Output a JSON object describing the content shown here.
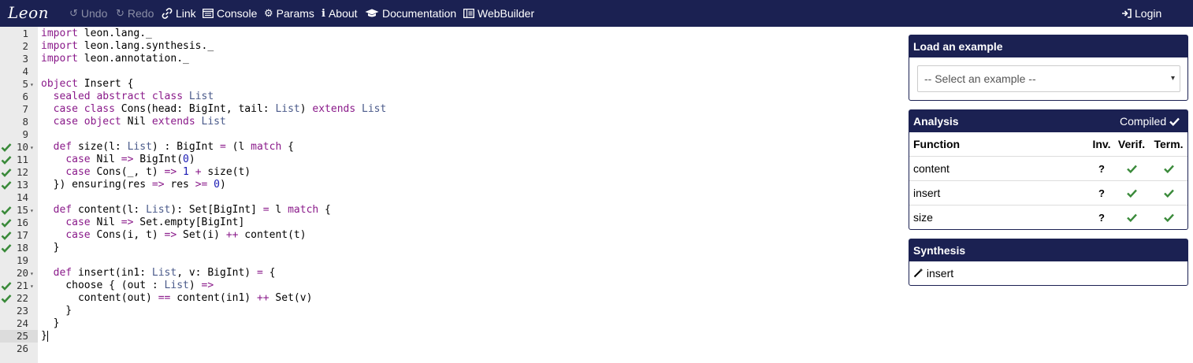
{
  "navbar": {
    "brand": "Leon",
    "items": [
      {
        "label": "Undo",
        "icon": "undo-icon",
        "enabled": false
      },
      {
        "label": "Redo",
        "icon": "redo-icon",
        "enabled": false
      },
      {
        "label": "Link",
        "icon": "link-icon",
        "enabled": true
      },
      {
        "label": "Console",
        "icon": "console-icon",
        "enabled": true
      },
      {
        "label": "Params",
        "icon": "gear-icon",
        "enabled": true
      },
      {
        "label": "About",
        "icon": "info-icon",
        "enabled": true
      },
      {
        "label": "Documentation",
        "icon": "graduation-cap-icon",
        "enabled": true
      },
      {
        "label": "WebBuilder",
        "icon": "webbuilder-icon",
        "enabled": true
      }
    ],
    "login": "Login"
  },
  "editor": {
    "active_line": 25,
    "lines": [
      {
        "n": "1",
        "check": false,
        "fold": false
      },
      {
        "n": "2",
        "check": false,
        "fold": false
      },
      {
        "n": "3",
        "check": false,
        "fold": false
      },
      {
        "n": "4",
        "check": false,
        "fold": false
      },
      {
        "n": "5",
        "check": false,
        "fold": true
      },
      {
        "n": "6",
        "check": false,
        "fold": false
      },
      {
        "n": "7",
        "check": false,
        "fold": false
      },
      {
        "n": "8",
        "check": false,
        "fold": false
      },
      {
        "n": "9",
        "check": false,
        "fold": false
      },
      {
        "n": "10",
        "check": true,
        "fold": true
      },
      {
        "n": "11",
        "check": true,
        "fold": false
      },
      {
        "n": "12",
        "check": true,
        "fold": false
      },
      {
        "n": "13",
        "check": true,
        "fold": false
      },
      {
        "n": "14",
        "check": false,
        "fold": false
      },
      {
        "n": "15",
        "check": true,
        "fold": true
      },
      {
        "n": "16",
        "check": true,
        "fold": false
      },
      {
        "n": "17",
        "check": true,
        "fold": false
      },
      {
        "n": "18",
        "check": true,
        "fold": false
      },
      {
        "n": "19",
        "check": false,
        "fold": false
      },
      {
        "n": "20",
        "check": false,
        "fold": true
      },
      {
        "n": "21",
        "check": true,
        "fold": true
      },
      {
        "n": "22",
        "check": true,
        "fold": false
      },
      {
        "n": "23",
        "check": false,
        "fold": false
      },
      {
        "n": "24",
        "check": false,
        "fold": false
      },
      {
        "n": "25",
        "check": false,
        "fold": false
      },
      {
        "n": "26",
        "check": false,
        "fold": false
      }
    ],
    "code": [
      [
        [
          "import",
          "kw"
        ],
        [
          " leon.lang._",
          ""
        ]
      ],
      [
        [
          "import",
          "kw"
        ],
        [
          " leon.lang.synthesis._",
          ""
        ]
      ],
      [
        [
          "import",
          "kw"
        ],
        [
          " leon.annotation._",
          ""
        ]
      ],
      [],
      [
        [
          "object",
          "kw"
        ],
        [
          " Insert {",
          ""
        ]
      ],
      [
        [
          "  ",
          ""
        ],
        [
          "sealed",
          "kw"
        ],
        [
          " ",
          ""
        ],
        [
          "abstract",
          "kw"
        ],
        [
          " ",
          ""
        ],
        [
          "class",
          "kw"
        ],
        [
          " ",
          ""
        ],
        [
          "List",
          "ty"
        ]
      ],
      [
        [
          "  ",
          ""
        ],
        [
          "case",
          "kw"
        ],
        [
          " ",
          ""
        ],
        [
          "class",
          "kw"
        ],
        [
          " Cons(head: BigInt, tail: ",
          ""
        ],
        [
          "List",
          "ty"
        ],
        [
          ") ",
          ""
        ],
        [
          "extends",
          "kw"
        ],
        [
          " ",
          ""
        ],
        [
          "List",
          "ty"
        ]
      ],
      [
        [
          "  ",
          ""
        ],
        [
          "case",
          "kw"
        ],
        [
          " ",
          ""
        ],
        [
          "object",
          "kw"
        ],
        [
          " Nil ",
          ""
        ],
        [
          "extends",
          "kw"
        ],
        [
          " ",
          ""
        ],
        [
          "List",
          "ty"
        ]
      ],
      [],
      [
        [
          "  ",
          ""
        ],
        [
          "def",
          "kw"
        ],
        [
          " size(l: ",
          ""
        ],
        [
          "List",
          "ty"
        ],
        [
          ") : BigInt ",
          ""
        ],
        [
          "=",
          "op"
        ],
        [
          " (l ",
          ""
        ],
        [
          "match",
          "kw"
        ],
        [
          " {",
          ""
        ]
      ],
      [
        [
          "    ",
          ""
        ],
        [
          "case",
          "kw"
        ],
        [
          " Nil ",
          ""
        ],
        [
          "=>",
          "op"
        ],
        [
          " BigInt(",
          ""
        ],
        [
          "0",
          "num"
        ],
        [
          ")",
          ""
        ]
      ],
      [
        [
          "    ",
          ""
        ],
        [
          "case",
          "kw"
        ],
        [
          " Cons(_, t) ",
          ""
        ],
        [
          "=>",
          "op"
        ],
        [
          " ",
          ""
        ],
        [
          "1",
          "num"
        ],
        [
          " ",
          ""
        ],
        [
          "+",
          "op"
        ],
        [
          " size(t)",
          ""
        ]
      ],
      [
        [
          "  }) ensuring(res ",
          ""
        ],
        [
          "=>",
          "op"
        ],
        [
          " res ",
          ""
        ],
        [
          ">=",
          "op"
        ],
        [
          " ",
          ""
        ],
        [
          "0",
          "num"
        ],
        [
          ")",
          ""
        ]
      ],
      [],
      [
        [
          "  ",
          ""
        ],
        [
          "def",
          "kw"
        ],
        [
          " content(l: ",
          ""
        ],
        [
          "List",
          "ty"
        ],
        [
          "): Set[BigInt] ",
          ""
        ],
        [
          "=",
          "op"
        ],
        [
          " l ",
          ""
        ],
        [
          "match",
          "kw"
        ],
        [
          " {",
          ""
        ]
      ],
      [
        [
          "    ",
          ""
        ],
        [
          "case",
          "kw"
        ],
        [
          " Nil ",
          ""
        ],
        [
          "=>",
          "op"
        ],
        [
          " Set.empty[BigInt]",
          ""
        ]
      ],
      [
        [
          "    ",
          ""
        ],
        [
          "case",
          "kw"
        ],
        [
          " Cons(i, t) ",
          ""
        ],
        [
          "=>",
          "op"
        ],
        [
          " Set(i) ",
          ""
        ],
        [
          "++",
          "op"
        ],
        [
          " content(t)",
          ""
        ]
      ],
      [
        [
          "  }",
          ""
        ]
      ],
      [],
      [
        [
          "  ",
          ""
        ],
        [
          "def",
          "kw"
        ],
        [
          " insert(in1: ",
          ""
        ],
        [
          "List",
          "ty"
        ],
        [
          ", v: BigInt) ",
          ""
        ],
        [
          "=",
          "op"
        ],
        [
          " {",
          ""
        ]
      ],
      [
        [
          "    choose { (out : ",
          ""
        ],
        [
          "List",
          "ty"
        ],
        [
          ") ",
          ""
        ],
        [
          "=>",
          "op"
        ]
      ],
      [
        [
          "      content(out) ",
          ""
        ],
        [
          "==",
          "op"
        ],
        [
          " content(in1) ",
          ""
        ],
        [
          "++",
          "op"
        ],
        [
          " Set(v)",
          ""
        ]
      ],
      [
        [
          "    }",
          ""
        ]
      ],
      [
        [
          "  }",
          ""
        ]
      ],
      [
        [
          "}",
          ""
        ]
      ],
      []
    ]
  },
  "examples": {
    "title": "Load an example",
    "placeholder": "-- Select an example --"
  },
  "analysis": {
    "title": "Analysis",
    "status": "Compiled",
    "columns": [
      "Function",
      "Inv.",
      "Verif.",
      "Term."
    ],
    "rows": [
      {
        "function": "content",
        "inv": "?",
        "verif": "ok",
        "term": "ok"
      },
      {
        "function": "insert",
        "inv": "?",
        "verif": "ok",
        "term": "ok"
      },
      {
        "function": "size",
        "inv": "?",
        "verif": "ok",
        "term": "ok"
      }
    ]
  },
  "synthesis": {
    "title": "Synthesis",
    "items": [
      "insert"
    ]
  },
  "colors": {
    "navbar": "#1b2152",
    "check": "#3a8a3a",
    "keyword": "#8a1a8a",
    "type": "#4a5a8a",
    "number": "#1a1ab4"
  }
}
